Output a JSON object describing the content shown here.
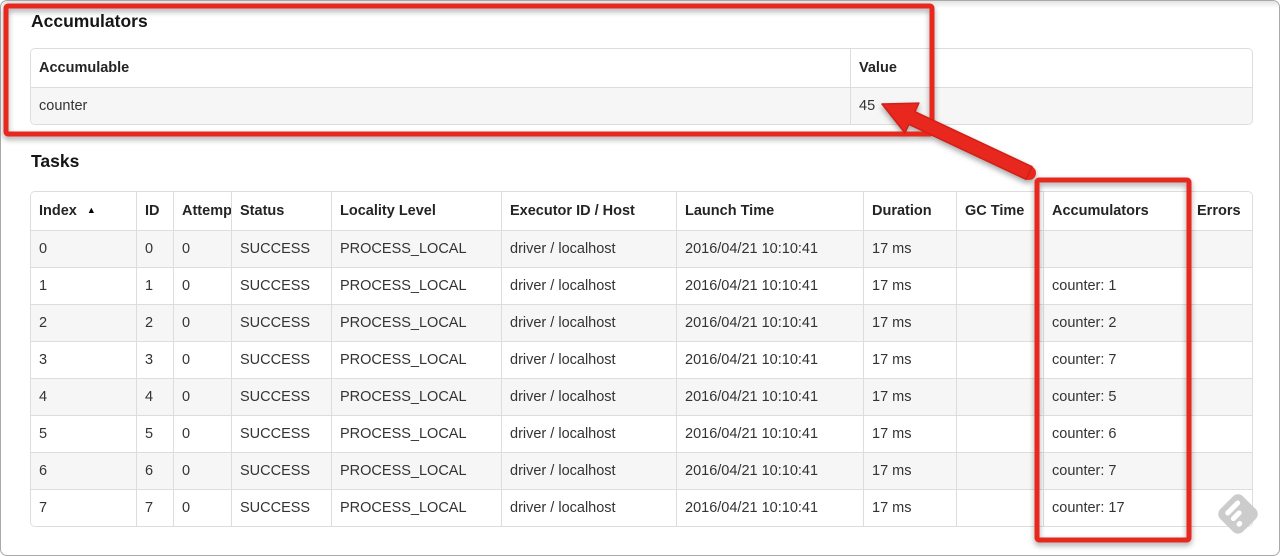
{
  "headings": {
    "accumulators": "Accumulators",
    "tasks": "Tasks"
  },
  "accumulators_table": {
    "headers": [
      "Accumulable",
      "Value"
    ],
    "rows": [
      [
        "counter",
        "45"
      ]
    ]
  },
  "tasks_table": {
    "sort_indicator": "▲",
    "headers": [
      "Index",
      "ID",
      "Attempt",
      "Status",
      "Locality Level",
      "Executor ID / Host",
      "Launch Time",
      "Duration",
      "GC Time",
      "Accumulators",
      "Errors"
    ],
    "rows": [
      [
        "0",
        "0",
        "0",
        "SUCCESS",
        "PROCESS_LOCAL",
        "driver / localhost",
        "2016/04/21 10:10:41",
        "17 ms",
        "",
        "",
        ""
      ],
      [
        "1",
        "1",
        "0",
        "SUCCESS",
        "PROCESS_LOCAL",
        "driver / localhost",
        "2016/04/21 10:10:41",
        "17 ms",
        "",
        "counter: 1",
        ""
      ],
      [
        "2",
        "2",
        "0",
        "SUCCESS",
        "PROCESS_LOCAL",
        "driver / localhost",
        "2016/04/21 10:10:41",
        "17 ms",
        "",
        "counter: 2",
        ""
      ],
      [
        "3",
        "3",
        "0",
        "SUCCESS",
        "PROCESS_LOCAL",
        "driver / localhost",
        "2016/04/21 10:10:41",
        "17 ms",
        "",
        "counter: 7",
        ""
      ],
      [
        "4",
        "4",
        "0",
        "SUCCESS",
        "PROCESS_LOCAL",
        "driver / localhost",
        "2016/04/21 10:10:41",
        "17 ms",
        "",
        "counter: 5",
        ""
      ],
      [
        "5",
        "5",
        "0",
        "SUCCESS",
        "PROCESS_LOCAL",
        "driver / localhost",
        "2016/04/21 10:10:41",
        "17 ms",
        "",
        "counter: 6",
        ""
      ],
      [
        "6",
        "6",
        "0",
        "SUCCESS",
        "PROCESS_LOCAL",
        "driver / localhost",
        "2016/04/21 10:10:41",
        "17 ms",
        "",
        "counter: 7",
        ""
      ],
      [
        "7",
        "7",
        "0",
        "SUCCESS",
        "PROCESS_LOCAL",
        "driver / localhost",
        "2016/04/21 10:10:41",
        "17 ms",
        "",
        "counter: 17",
        ""
      ]
    ]
  },
  "annotations": {
    "color": "#e8281e"
  },
  "watermark": {
    "color": "#cccccc"
  }
}
